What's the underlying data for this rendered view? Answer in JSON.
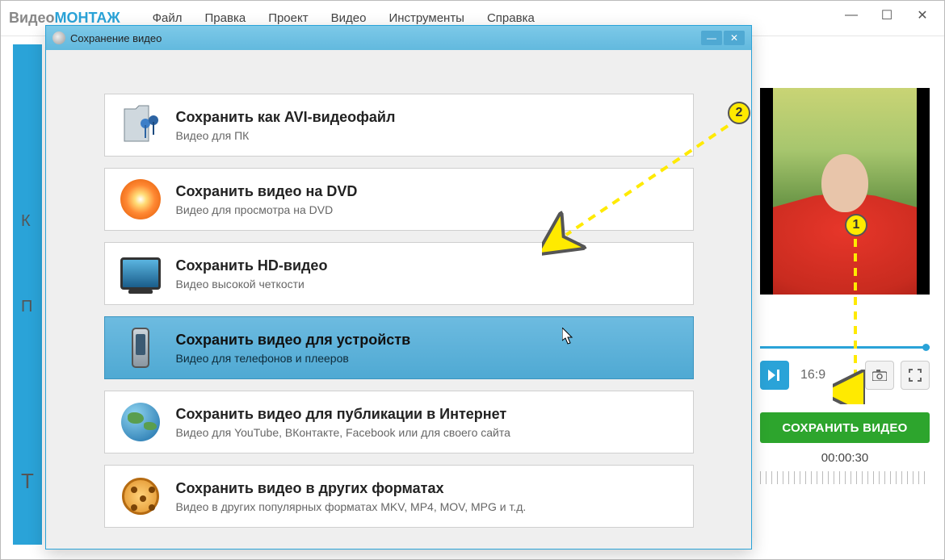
{
  "app": {
    "name_part1": "Видео",
    "name_part2": "МОНТАЖ"
  },
  "menu": [
    "Файл",
    "Правка",
    "Проект",
    "Видео",
    "Инструменты",
    "Справка"
  ],
  "dialog": {
    "title": "Сохранение видео",
    "options": [
      {
        "title": "Сохранить как AVI-видеофайл",
        "sub": "Видео для ПК",
        "icon": "avi"
      },
      {
        "title": "Сохранить видео на DVD",
        "sub": "Видео для просмотра на DVD",
        "icon": "dvd"
      },
      {
        "title": "Сохранить HD-видео",
        "sub": "Видео высокой четкости",
        "icon": "tv"
      },
      {
        "title": "Сохранить видео для устройств",
        "sub": "Видео для телефонов и плееров",
        "icon": "phone"
      },
      {
        "title": "Сохранить видео для публикации в Интернет",
        "sub": "Видео для YouTube, ВКонтакте, Facebook или для своего сайта",
        "icon": "globe"
      },
      {
        "title": "Сохранить видео в других форматах",
        "sub": "Видео в других популярных форматах MKV, MP4, MOV, MPG и т.д.",
        "icon": "reel"
      }
    ]
  },
  "preview": {
    "aspect_ratio": "16:9",
    "save_button": "СОХРАНИТЬ ВИДЕО",
    "duration": "00:00:30"
  },
  "annotations": {
    "badge1": "1",
    "badge2": "2"
  },
  "bg_labels": {
    "k": "К",
    "p": "П",
    "t": "Т"
  }
}
